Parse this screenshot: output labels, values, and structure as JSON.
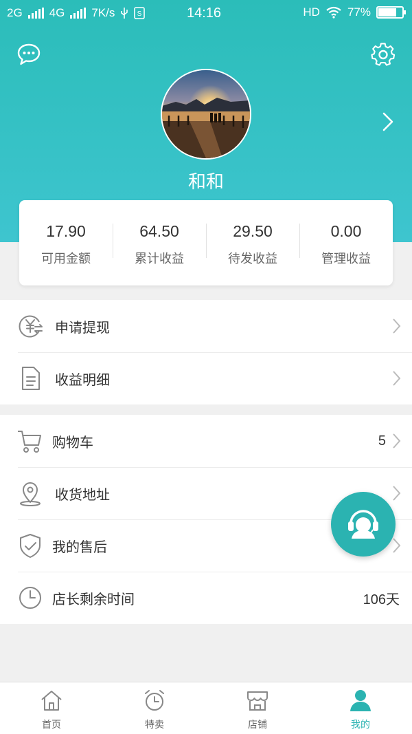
{
  "status_bar": {
    "network1": "2G",
    "network2": "4G",
    "speed": "7K/s",
    "time": "14:16",
    "hd": "HD",
    "battery": "77%"
  },
  "profile": {
    "nickname": "和和"
  },
  "stats": [
    {
      "value": "17.90",
      "label": "可用金额"
    },
    {
      "value": "64.50",
      "label": "累计收益"
    },
    {
      "value": "29.50",
      "label": "待发收益"
    },
    {
      "value": "0.00",
      "label": "管理收益"
    }
  ],
  "group1": [
    {
      "label": "申请提现",
      "icon": "yuan-exchange-icon"
    },
    {
      "label": "收益明细",
      "icon": "document-icon"
    }
  ],
  "group2": [
    {
      "label": "购物车",
      "value": "5",
      "icon": "cart-icon"
    },
    {
      "label": "收货地址",
      "value": "",
      "icon": "location-pin-icon"
    },
    {
      "label": "我的售后",
      "value": "",
      "icon": "shield-check-icon"
    },
    {
      "label": "店长剩余时间",
      "value": "106天",
      "icon": "clock-icon"
    }
  ],
  "tabbar": [
    {
      "label": "首页",
      "icon": "home-icon"
    },
    {
      "label": "特卖",
      "icon": "alarm-clock-icon"
    },
    {
      "label": "店铺",
      "icon": "store-icon"
    },
    {
      "label": "我的",
      "icon": "person-icon",
      "active": true
    }
  ],
  "colors": {
    "accent": "#2bb3b1",
    "header_top": "#2bbdb9",
    "header_bottom": "#3ec5cf"
  }
}
